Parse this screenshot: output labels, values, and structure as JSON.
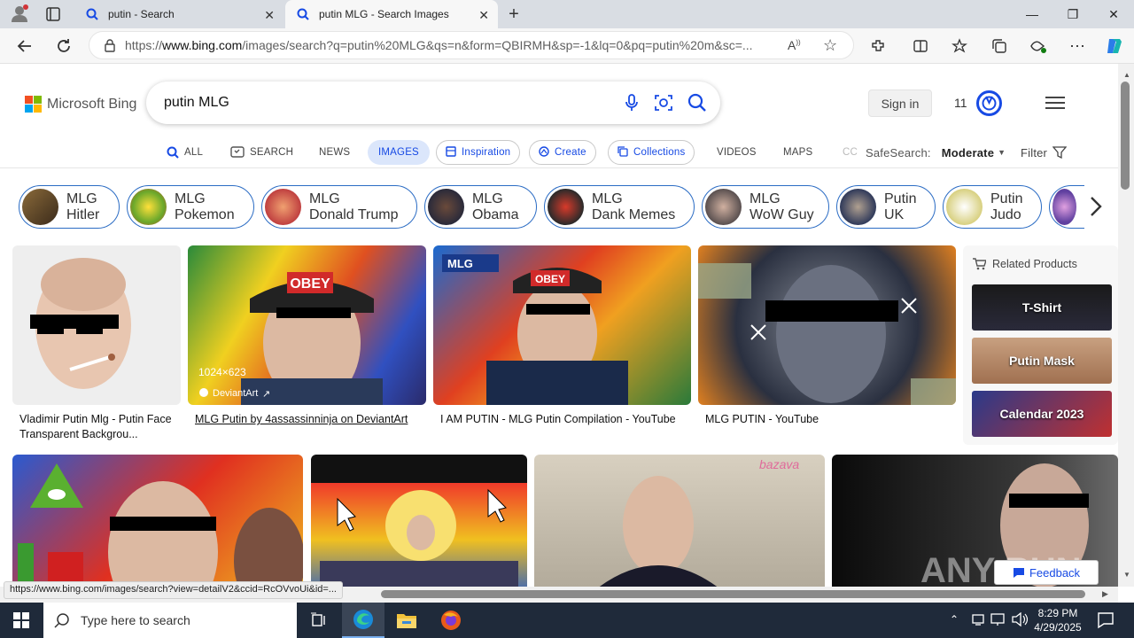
{
  "browser": {
    "tabs": [
      {
        "title": "putin - Search"
      },
      {
        "title": "putin MLG - Search Images"
      }
    ],
    "url_prefix": "https://",
    "url_host": "www.bing.com",
    "url_path": "/images/search?q=putin%20MLG&qs=n&form=QBIRMH&sp=-1&lq=0&pq=putin%20m&sc=..."
  },
  "bing": {
    "logo_text": "Microsoft Bing",
    "query": "putin MLG",
    "sign_in": "Sign in",
    "rewards_count": "11",
    "nav": [
      "ALL",
      "SEARCH",
      "NEWS",
      "IMAGES",
      "Inspiration",
      "Create",
      "Collections",
      "VIDEOS",
      "MAPS",
      "CC"
    ],
    "safesearch_label": "SafeSearch:",
    "safesearch_value": "Moderate",
    "filter_label": "Filter"
  },
  "chips": [
    {
      "line1": "MLG",
      "line2": "Hitler"
    },
    {
      "line1": "MLG",
      "line2": "Pokemon"
    },
    {
      "line1": "MLG",
      "line2": "Donald Trump"
    },
    {
      "line1": "MLG",
      "line2": "Obama"
    },
    {
      "line1": "MLG",
      "line2": "Dank Memes"
    },
    {
      "line1": "MLG",
      "line2": "WoW Guy"
    },
    {
      "line1": "Putin",
      "line2": "UK"
    },
    {
      "line1": "Putin",
      "line2": "Judo"
    }
  ],
  "results": [
    {
      "caption": "Vladimir Putin Mlg - Putin Face Transparent Backgrou..."
    },
    {
      "caption": "MLG Putin by 4assassinninja on DeviantArt",
      "dims": "1024×623",
      "source": "DeviantArt"
    },
    {
      "caption": "I AM PUTIN - MLG Putin Compilation - YouTube"
    },
    {
      "caption": "MLG PUTIN - YouTube"
    }
  ],
  "image_text": {
    "obey": "OBEY",
    "mlg": "MLG",
    "bazava": "bazava",
    "watermark": "ANY RUN"
  },
  "related_products": {
    "title": "Related Products",
    "items": [
      "T-Shirt",
      "Putin Mask",
      "Calendar 2023"
    ]
  },
  "feedback": "Feedback",
  "status_url": "https://www.bing.com/images/search?view=detailV2&ccid=RcOVvoUi&id=...",
  "taskbar": {
    "search_placeholder": "Type here to search",
    "time": "8:29 PM",
    "date": "4/29/2025"
  }
}
